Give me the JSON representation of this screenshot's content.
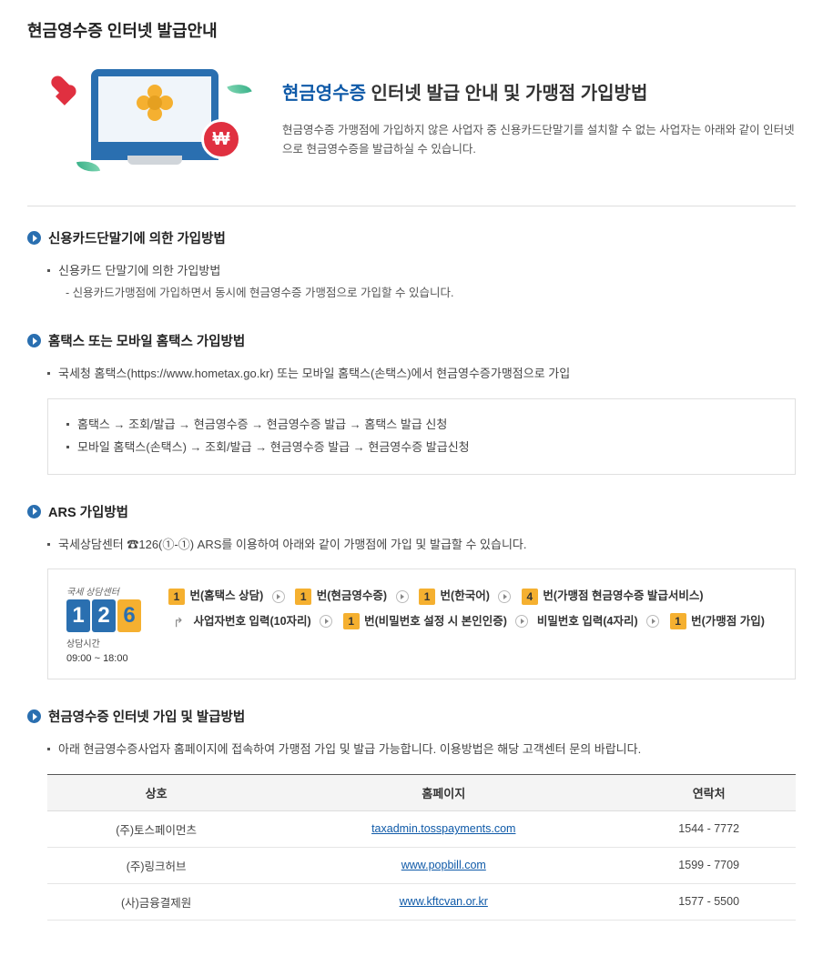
{
  "page_title": "현금영수증 인터넷 발급안내",
  "hero": {
    "title_em": "현금영수증",
    "title_rest": " 인터넷 발급 안내 및 가맹점 가입방법",
    "desc": "현금영수증 가맹점에 가입하지 않은 사업자 중 신용카드단말기를 설치할 수 없는 사업자는 아래와 같이 인터넷으로 현금영수증을 발급하실 수 있습니다."
  },
  "sections": {
    "card": {
      "heading": "신용카드단말기에 의한 가입방법",
      "item1": "신용카드 단말기에 의한 가입방법",
      "sub1": "- 신용카드가맹점에 가입하면서 동시에 현금영수증 가맹점으로 가입할 수 있습니다."
    },
    "hometax": {
      "heading": "홈택스 또는 모바일 홈택스 가입방법",
      "item1": "국세청 홈택스(https://www.hometax.go.kr) 또는 모바일 홈택스(손택스)에서 현금영수증가맹점으로 가입",
      "box1": "홈택스 → 조회/발급 → 현금영수증 → 현금영수증 발급 → 홈택스 발급 신청",
      "box2": "모바일 홈택스(손택스) → 조회/발급 → 현금영수증 발급 → 현금영수증 발급신청"
    },
    "ars": {
      "heading": "ARS 가입방법",
      "item1": "국세상담센터 ☎126(①-①) ARS를 이용하여 아래와 같이 가맹점에 가입 및 발급할 수 있습니다.",
      "logo_brand": "국세 상담센터",
      "logo_digits": [
        "1",
        "2",
        "6"
      ],
      "logo_hours_label": "상담시간",
      "logo_hours": "09:00 ~ 18:00",
      "steps": {
        "s1n": "1",
        "s1t": "번(홈택스 상담)",
        "s2n": "1",
        "s2t": "번(현금영수증)",
        "s3n": "1",
        "s3t": "번(한국어)",
        "s4n": "4",
        "s4t": "번(가맹점 현금영수증 발급서비스)",
        "s5t": "사업자번호 입력(10자리)",
        "s6n": "1",
        "s6t": "번(비밀번호 설정 시 본인인증)",
        "s7t": "비밀번호 입력(4자리)",
        "s8n": "1",
        "s8t": "번(가맹점 가입)"
      }
    },
    "internet": {
      "heading": "현금영수증 인터넷 가입 및 발급방법",
      "item1": "아래 현금영수증사업자 홈페이지에 접속하여 가맹점 가입 및 발급 가능합니다. 이용방법은 해당 고객센터 문의 바랍니다.",
      "cols": {
        "c1": "상호",
        "c2": "홈페이지",
        "c3": "연락처"
      },
      "rows": [
        {
          "name": "(주)토스페이먼츠",
          "url": "taxadmin.tosspayments.com",
          "tel": "1544 - 7772"
        },
        {
          "name": "(주)링크허브",
          "url": "www.popbill.com",
          "tel": "1599 - 7709"
        },
        {
          "name": "(사)금융결제원",
          "url": "www.kftcvan.or.kr",
          "tel": "1577 - 5500"
        }
      ]
    }
  }
}
